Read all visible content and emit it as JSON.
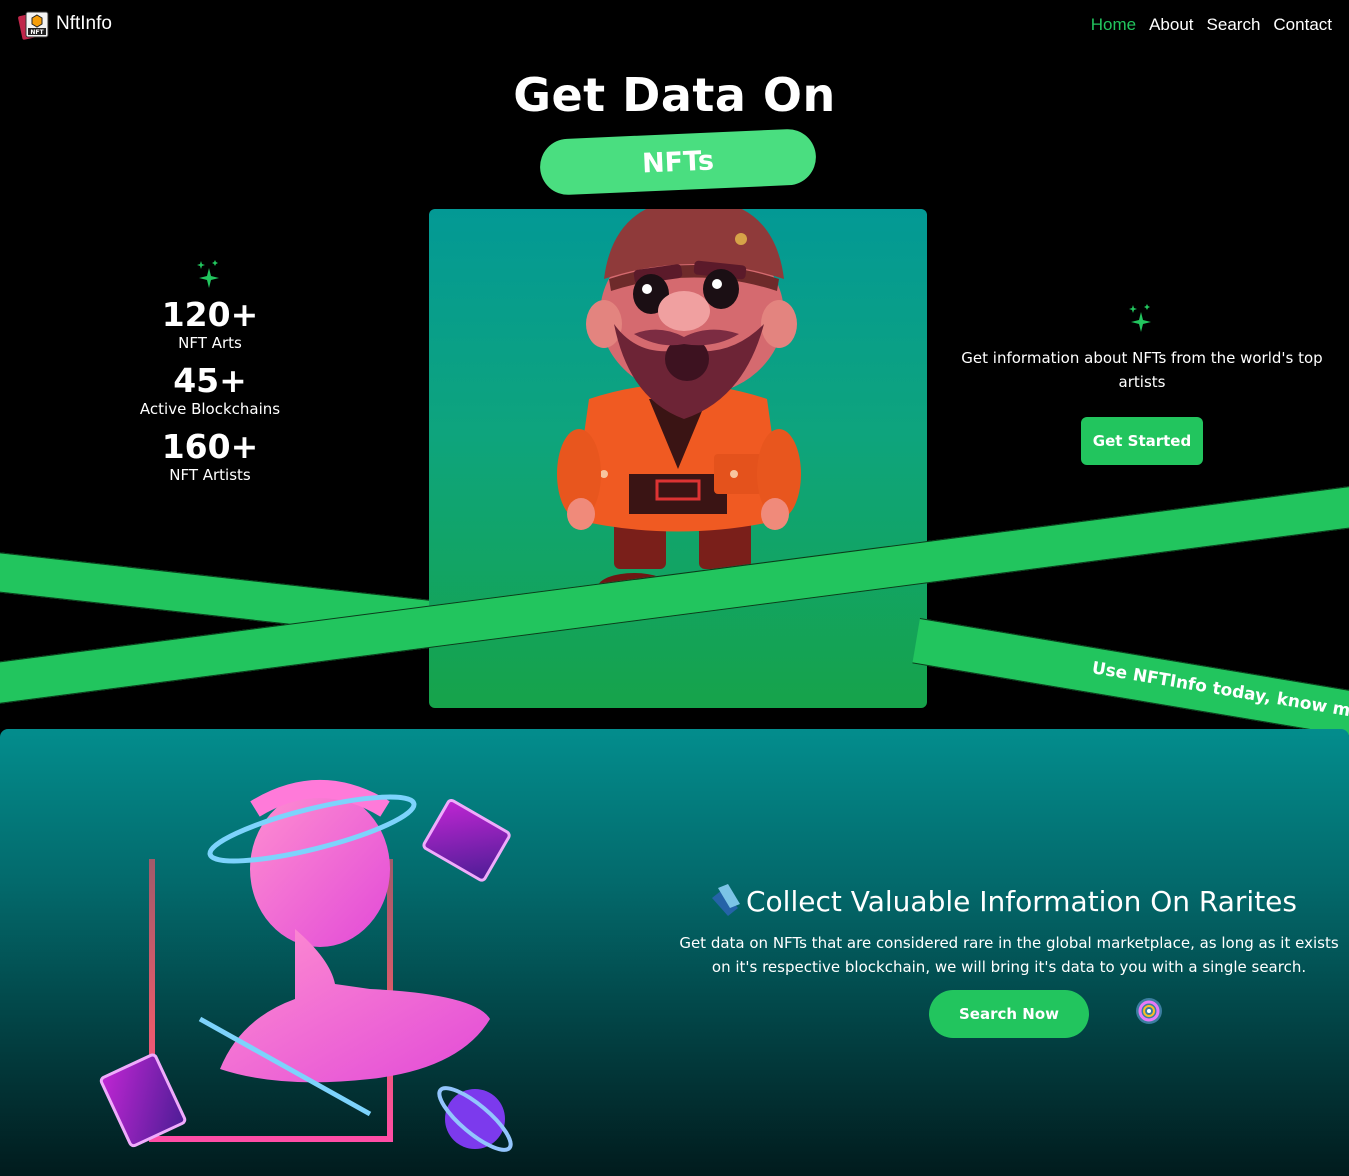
{
  "nav": {
    "brand": "NftInfo",
    "items": [
      {
        "label": "Home",
        "active": true
      },
      {
        "label": "About",
        "active": false
      },
      {
        "label": "Search",
        "active": false
      },
      {
        "label": "Contact",
        "active": false
      }
    ]
  },
  "hero": {
    "title": "Get Data On",
    "pill": "NFTs",
    "stats": [
      {
        "value": "120+",
        "label": "NFT Arts"
      },
      {
        "value": "45+",
        "label": "Active Blockchains"
      },
      {
        "value": "160+",
        "label": "NFT Artists"
      }
    ],
    "info_text": "Get information about NFTs from the world's top artists",
    "cta": "Get Started",
    "marquee": "Use NFTInfo today, know more"
  },
  "section2": {
    "title": "Collect Valuable Information On Rarites",
    "text": "Get data on NFTs that are considered rare in the global marketplace, as long as it exists on it's respective blockchain, we will bring it's data to you with a single search.",
    "cta": "Search Now"
  },
  "colors": {
    "accent": "#22c55e",
    "pill": "#4ade80",
    "active_nav": "#22c55e"
  }
}
